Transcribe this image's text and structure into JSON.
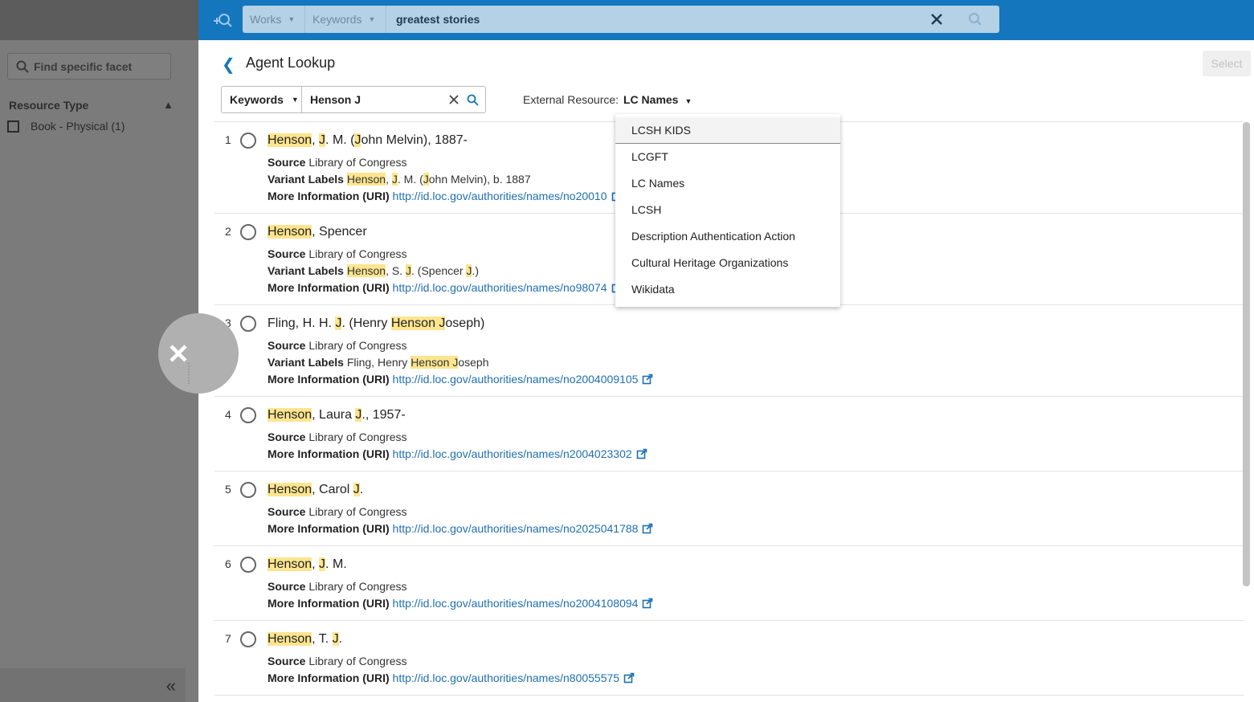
{
  "header": {
    "search_type": "Works",
    "search_field": "Keywords",
    "query": "greatest stories"
  },
  "sidebar": {
    "facet_search_placeholder": "Find specific facet",
    "resource_type_heading": "Resource Type",
    "facet_items": [
      {
        "label": "Book - Physical (1)"
      }
    ]
  },
  "panel": {
    "title": "Agent Lookup",
    "select_label": "Select",
    "lookup_field": "Keywords",
    "lookup_value": "Henson J",
    "external_resource_label": "External Resource:",
    "external_resource_value": "LC Names"
  },
  "menu": {
    "options": [
      "LCSH KIDS",
      "LCGFT",
      "LC Names",
      "LCSH",
      "Description Authentication Action",
      "Cultural Heritage Organizations",
      "Wikidata"
    ],
    "active_index": 0
  },
  "labels": {
    "source": "Source",
    "variant": "Variant Labels",
    "more_info": "More Information (URI)"
  },
  "results": [
    {
      "num": "1",
      "title": "Henson, J. M. (John Melvin), 1887-",
      "source": "Library of Congress",
      "variant": "Henson, J. M. (John Melvin), b. 1887",
      "uri": "http://id.loc.gov/authorities/names/no20010"
    },
    {
      "num": "2",
      "title": "Henson, Spencer",
      "source": "Library of Congress",
      "variant": "Henson, S. J. (Spencer J.)",
      "uri": "http://id.loc.gov/authorities/names/no98074"
    },
    {
      "num": "3",
      "title": "Fling, H. H. J. (Henry Henson Joseph)",
      "source": "Library of Congress",
      "variant": "Fling, Henry Henson Joseph",
      "uri": "http://id.loc.gov/authorities/names/no2004009105"
    },
    {
      "num": "4",
      "title": "Henson, Laura J., 1957-",
      "source": "Library of Congress",
      "variant": null,
      "uri": "http://id.loc.gov/authorities/names/n2004023302"
    },
    {
      "num": "5",
      "title": "Henson, Carol J.",
      "source": "Library of Congress",
      "variant": null,
      "uri": "http://id.loc.gov/authorities/names/no2025041788"
    },
    {
      "num": "6",
      "title": "Henson, J. M.",
      "source": "Library of Congress",
      "variant": null,
      "uri": "http://id.loc.gov/authorities/names/no2004108094"
    },
    {
      "num": "7",
      "title": "Henson, T. J.",
      "source": "Library of Congress",
      "variant": null,
      "uri": "http://id.loc.gov/authorities/names/n80055575"
    }
  ],
  "colors": {
    "header_blue": "#1476bd",
    "highlight": "#fde58f",
    "link": "#1e6fb3"
  }
}
